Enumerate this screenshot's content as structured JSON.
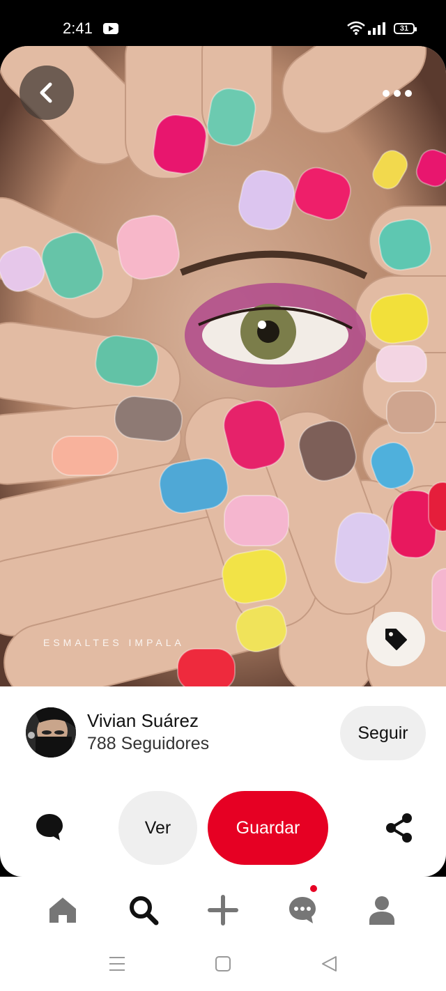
{
  "status_bar": {
    "time": "2:41",
    "battery": "31",
    "icons": [
      "youtube-icon",
      "wifi-icon",
      "signal-icon",
      "battery-icon"
    ]
  },
  "pin": {
    "watermark": "ESMALTES IMPALA",
    "top_controls": [
      "back-arrow-icon",
      "more-dots-icon"
    ],
    "tag_icon": "tag-icon"
  },
  "author": {
    "name": "Vivian Suárez",
    "followers": "788 Seguidores",
    "follow_label": "Seguir"
  },
  "actions": {
    "view_label": "Ver",
    "save_label": "Guardar",
    "comment_icon": "comment-icon",
    "share_icon": "share-icon"
  },
  "bottom_nav": {
    "items": [
      "home-icon",
      "search-icon",
      "add-icon",
      "messages-icon",
      "profile-icon"
    ]
  },
  "system_nav": [
    "recents",
    "home",
    "back"
  ],
  "colors": {
    "save_red": "#e60023",
    "button_gray": "#efefef"
  }
}
